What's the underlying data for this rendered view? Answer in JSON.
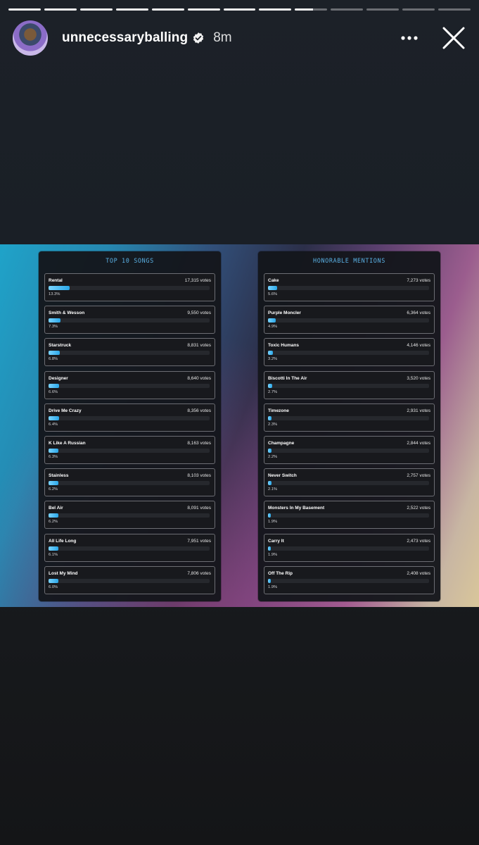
{
  "story": {
    "segment_count": 13,
    "completed_segments": 8,
    "current_segment_progress": 0.55,
    "username": "unnecessaryballing",
    "time": "8m",
    "verified": true,
    "icons": {
      "more": "more-icon",
      "close": "close-icon",
      "verified": "verified-badge-icon"
    }
  },
  "poster": {
    "left_title": "TOP 10 SONGS",
    "right_title": "HONORABLE MENTIONS",
    "top_songs": [
      {
        "name": "Rental",
        "votes": "17,315 votes",
        "percent_label": "13.3%",
        "percent": 13.3
      },
      {
        "name": "Smith & Wesson",
        "votes": "9,550 votes",
        "percent_label": "7.3%",
        "percent": 7.3
      },
      {
        "name": "Starstruck",
        "votes": "8,831 votes",
        "percent_label": "6.8%",
        "percent": 6.8
      },
      {
        "name": "Designer",
        "votes": "8,640 votes",
        "percent_label": "6.6%",
        "percent": 6.6
      },
      {
        "name": "Drive Me Crazy",
        "votes": "8,356 votes",
        "percent_label": "6.4%",
        "percent": 6.4
      },
      {
        "name": "K Like A Russian",
        "votes": "8,163 votes",
        "percent_label": "6.3%",
        "percent": 6.3
      },
      {
        "name": "Stainless",
        "votes": "8,103 votes",
        "percent_label": "6.2%",
        "percent": 6.2
      },
      {
        "name": "Bel Air",
        "votes": "8,091 votes",
        "percent_label": "6.2%",
        "percent": 6.2
      },
      {
        "name": "All Life Long",
        "votes": "7,951 votes",
        "percent_label": "6.1%",
        "percent": 6.1
      },
      {
        "name": "Lost My Mind",
        "votes": "7,806 votes",
        "percent_label": "6.0%",
        "percent": 6.0
      }
    ],
    "honorable_mentions": [
      {
        "name": "Cake",
        "votes": "7,273 votes",
        "percent_label": "5.6%",
        "percent": 5.6
      },
      {
        "name": "Purple Moncler",
        "votes": "6,364 votes",
        "percent_label": "4.9%",
        "percent": 4.9
      },
      {
        "name": "Toxic Humans",
        "votes": "4,146 votes",
        "percent_label": "3.2%",
        "percent": 3.2
      },
      {
        "name": "Biscotti In The Air",
        "votes": "3,520 votes",
        "percent_label": "2.7%",
        "percent": 2.7
      },
      {
        "name": "Timezone",
        "votes": "2,931 votes",
        "percent_label": "2.3%",
        "percent": 2.3
      },
      {
        "name": "Champagne",
        "votes": "2,844 votes",
        "percent_label": "2.2%",
        "percent": 2.2
      },
      {
        "name": "Never Switch",
        "votes": "2,757 votes",
        "percent_label": "2.1%",
        "percent": 2.1
      },
      {
        "name": "Monsters In My Basement",
        "votes": "2,522 votes",
        "percent_label": "1.9%",
        "percent": 1.9
      },
      {
        "name": "Carry It",
        "votes": "2,473 votes",
        "percent_label": "1.9%",
        "percent": 1.9
      },
      {
        "name": "Off The Rip",
        "votes": "2,408 votes",
        "percent_label": "1.9%",
        "percent": 1.9
      }
    ]
  },
  "colors": {
    "accent": "#5ab0e3",
    "bar": "#2aa7e8"
  }
}
